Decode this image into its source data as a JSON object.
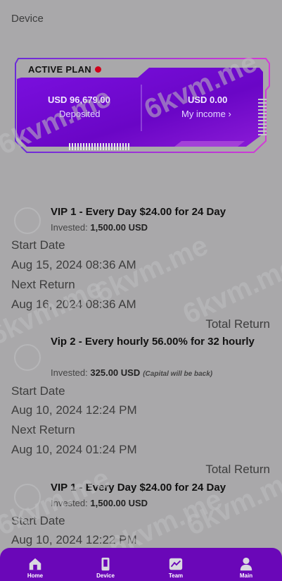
{
  "header": {
    "title": "Device"
  },
  "active_plan": {
    "label": "ACTIVE PLAN",
    "deposited_amount": "USD 96,679.00",
    "deposited_label": "Deposited",
    "income_amount": "USD 0.00",
    "income_label": "My income"
  },
  "plans": [
    {
      "name": "VIP 1 - Every Day $24.00 for 24 Day",
      "invested_label": "Invested:",
      "invested_value": "1,500.00 USD",
      "note": "",
      "start_label": "Start Date",
      "start_value": "Aug 15, 2024 08:36 AM",
      "next_label": "Next Return",
      "next_value": "Aug 16, 2024 08:36 AM",
      "total_label": "Total Return"
    },
    {
      "name": "Vip 2 - Every hourly 56.00% for 32 hourly",
      "invested_label": "Invested:",
      "invested_value": "325.00 USD",
      "note": "(Capital will be back)",
      "start_label": "Start Date",
      "start_value": "Aug 10, 2024 12:24 PM",
      "next_label": "Next Return",
      "next_value": "Aug 10, 2024 01:24 PM",
      "total_label": "Total Return"
    },
    {
      "name": "VIP 1 - Every Day $24.00 for 24 Day",
      "invested_label": "Invested:",
      "invested_value": "1,500.00 USD",
      "start_label": "Start Date",
      "start_value": "Aug 10, 2024 12:22 PM"
    }
  ],
  "watermark": "6kvm.me",
  "nav": {
    "items": [
      {
        "label": "Home",
        "icon": "home-icon"
      },
      {
        "label": "Device",
        "icon": "device-icon"
      },
      {
        "label": "Team",
        "icon": "team-chart-icon"
      },
      {
        "label": "Main",
        "icon": "user-icon"
      }
    ],
    "color": "#6a07b8"
  }
}
